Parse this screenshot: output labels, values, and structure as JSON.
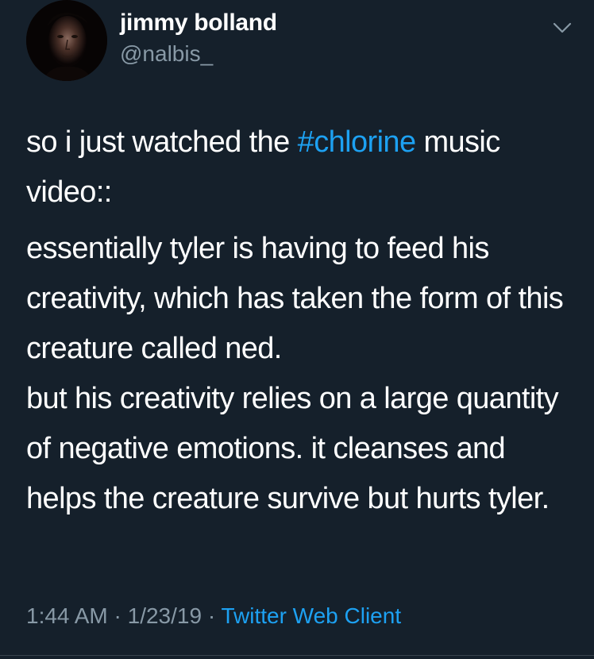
{
  "user": {
    "display_name": "jimmy bolland",
    "handle": "@nalbis_"
  },
  "icons": {
    "menu": "chevron-down-icon"
  },
  "tweet": {
    "para1_before": "so i just watched the ",
    "hashtag": "#chlorine",
    "para1_after": " music video::",
    "line2": "essentially tyler is having to feed his creativity, which has taken the form of this creature called ned.",
    "line3": "but his creativity relies on a large quantity of negative emotions. it cleanses and helps the creature survive but hurts tyler."
  },
  "meta": {
    "time": "1:44 AM",
    "sep1": " · ",
    "date": "1/23/19",
    "sep2": " · ",
    "source": "Twitter Web Client"
  },
  "colors": {
    "background": "#15202b",
    "link": "#1da1f2",
    "secondary_text": "#8899a6"
  }
}
